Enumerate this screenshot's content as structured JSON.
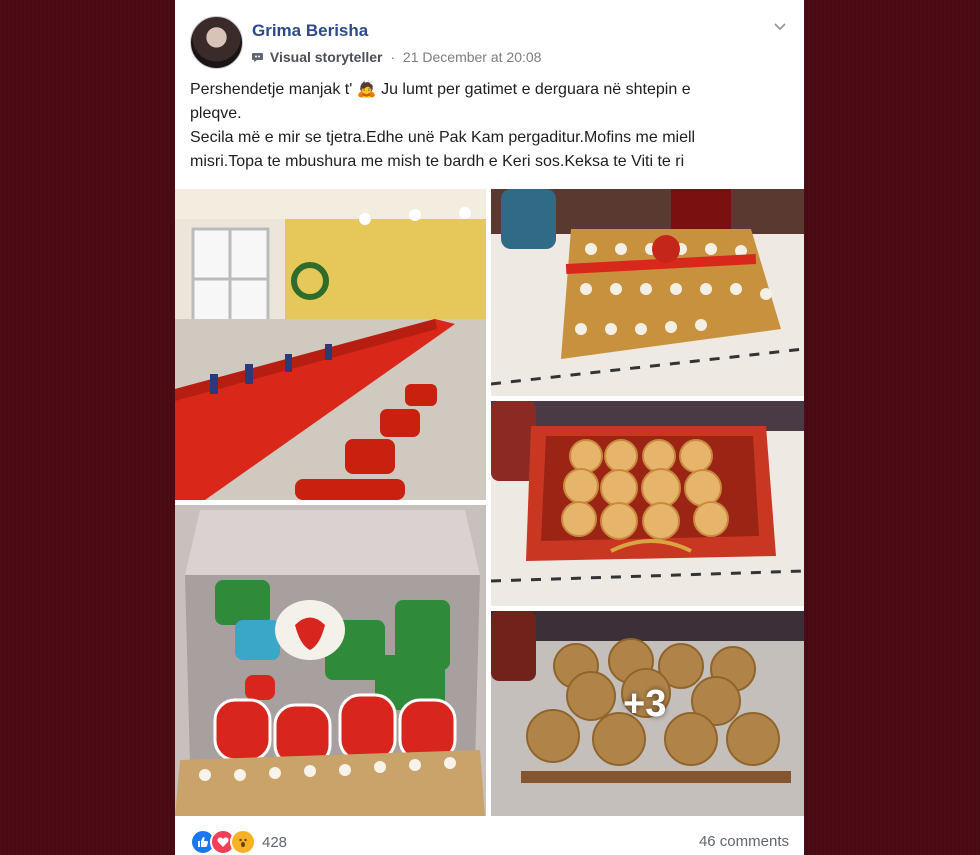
{
  "post": {
    "author": "Grima Berisha",
    "badge": "Visual storyteller",
    "separator": "·",
    "timestamp": "21 December at 20:08",
    "caption_lines": [
      "Pershendetje manjak t' 🙇 Ju lumt per gatimet e derguara në shtepin e",
      "pleqve.",
      "Secila më e mir se tjetra.Edhe unë Pak Kam pergaditur.Mofins me miell",
      "misri.Topa te mbushura me mish te bardh e Keri sos.Keksa te Viti te ri"
    ],
    "more_photos": "+3",
    "reaction_count": "428",
    "comments": "46 comments"
  },
  "icons": {
    "menu": "chevron-down-icon",
    "badge": "storyteller-badge-icon",
    "reactions": [
      "like-icon",
      "love-icon",
      "wow-icon"
    ]
  },
  "colors": {
    "background": "#4a0b14",
    "author": "#2d4a8a",
    "like": "#1877f2",
    "love": "#f33e58",
    "wow": "#f7b125"
  }
}
